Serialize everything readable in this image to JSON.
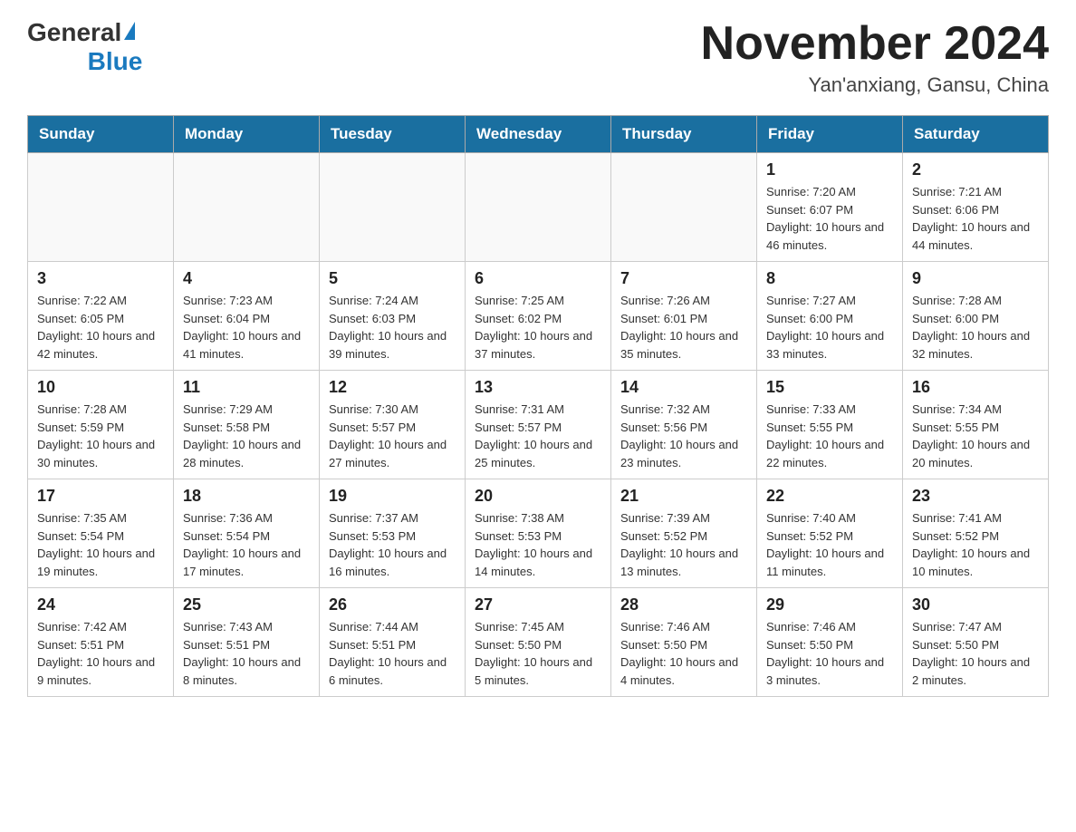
{
  "header": {
    "logo_general": "General",
    "logo_blue": "Blue",
    "month_title": "November 2024",
    "location": "Yan'anxiang, Gansu, China"
  },
  "days_of_week": [
    "Sunday",
    "Monday",
    "Tuesday",
    "Wednesday",
    "Thursday",
    "Friday",
    "Saturday"
  ],
  "weeks": [
    [
      {
        "day": "",
        "info": ""
      },
      {
        "day": "",
        "info": ""
      },
      {
        "day": "",
        "info": ""
      },
      {
        "day": "",
        "info": ""
      },
      {
        "day": "",
        "info": ""
      },
      {
        "day": "1",
        "info": "Sunrise: 7:20 AM\nSunset: 6:07 PM\nDaylight: 10 hours and 46 minutes."
      },
      {
        "day": "2",
        "info": "Sunrise: 7:21 AM\nSunset: 6:06 PM\nDaylight: 10 hours and 44 minutes."
      }
    ],
    [
      {
        "day": "3",
        "info": "Sunrise: 7:22 AM\nSunset: 6:05 PM\nDaylight: 10 hours and 42 minutes."
      },
      {
        "day": "4",
        "info": "Sunrise: 7:23 AM\nSunset: 6:04 PM\nDaylight: 10 hours and 41 minutes."
      },
      {
        "day": "5",
        "info": "Sunrise: 7:24 AM\nSunset: 6:03 PM\nDaylight: 10 hours and 39 minutes."
      },
      {
        "day": "6",
        "info": "Sunrise: 7:25 AM\nSunset: 6:02 PM\nDaylight: 10 hours and 37 minutes."
      },
      {
        "day": "7",
        "info": "Sunrise: 7:26 AM\nSunset: 6:01 PM\nDaylight: 10 hours and 35 minutes."
      },
      {
        "day": "8",
        "info": "Sunrise: 7:27 AM\nSunset: 6:00 PM\nDaylight: 10 hours and 33 minutes."
      },
      {
        "day": "9",
        "info": "Sunrise: 7:28 AM\nSunset: 6:00 PM\nDaylight: 10 hours and 32 minutes."
      }
    ],
    [
      {
        "day": "10",
        "info": "Sunrise: 7:28 AM\nSunset: 5:59 PM\nDaylight: 10 hours and 30 minutes."
      },
      {
        "day": "11",
        "info": "Sunrise: 7:29 AM\nSunset: 5:58 PM\nDaylight: 10 hours and 28 minutes."
      },
      {
        "day": "12",
        "info": "Sunrise: 7:30 AM\nSunset: 5:57 PM\nDaylight: 10 hours and 27 minutes."
      },
      {
        "day": "13",
        "info": "Sunrise: 7:31 AM\nSunset: 5:57 PM\nDaylight: 10 hours and 25 minutes."
      },
      {
        "day": "14",
        "info": "Sunrise: 7:32 AM\nSunset: 5:56 PM\nDaylight: 10 hours and 23 minutes."
      },
      {
        "day": "15",
        "info": "Sunrise: 7:33 AM\nSunset: 5:55 PM\nDaylight: 10 hours and 22 minutes."
      },
      {
        "day": "16",
        "info": "Sunrise: 7:34 AM\nSunset: 5:55 PM\nDaylight: 10 hours and 20 minutes."
      }
    ],
    [
      {
        "day": "17",
        "info": "Sunrise: 7:35 AM\nSunset: 5:54 PM\nDaylight: 10 hours and 19 minutes."
      },
      {
        "day": "18",
        "info": "Sunrise: 7:36 AM\nSunset: 5:54 PM\nDaylight: 10 hours and 17 minutes."
      },
      {
        "day": "19",
        "info": "Sunrise: 7:37 AM\nSunset: 5:53 PM\nDaylight: 10 hours and 16 minutes."
      },
      {
        "day": "20",
        "info": "Sunrise: 7:38 AM\nSunset: 5:53 PM\nDaylight: 10 hours and 14 minutes."
      },
      {
        "day": "21",
        "info": "Sunrise: 7:39 AM\nSunset: 5:52 PM\nDaylight: 10 hours and 13 minutes."
      },
      {
        "day": "22",
        "info": "Sunrise: 7:40 AM\nSunset: 5:52 PM\nDaylight: 10 hours and 11 minutes."
      },
      {
        "day": "23",
        "info": "Sunrise: 7:41 AM\nSunset: 5:52 PM\nDaylight: 10 hours and 10 minutes."
      }
    ],
    [
      {
        "day": "24",
        "info": "Sunrise: 7:42 AM\nSunset: 5:51 PM\nDaylight: 10 hours and 9 minutes."
      },
      {
        "day": "25",
        "info": "Sunrise: 7:43 AM\nSunset: 5:51 PM\nDaylight: 10 hours and 8 minutes."
      },
      {
        "day": "26",
        "info": "Sunrise: 7:44 AM\nSunset: 5:51 PM\nDaylight: 10 hours and 6 minutes."
      },
      {
        "day": "27",
        "info": "Sunrise: 7:45 AM\nSunset: 5:50 PM\nDaylight: 10 hours and 5 minutes."
      },
      {
        "day": "28",
        "info": "Sunrise: 7:46 AM\nSunset: 5:50 PM\nDaylight: 10 hours and 4 minutes."
      },
      {
        "day": "29",
        "info": "Sunrise: 7:46 AM\nSunset: 5:50 PM\nDaylight: 10 hours and 3 minutes."
      },
      {
        "day": "30",
        "info": "Sunrise: 7:47 AM\nSunset: 5:50 PM\nDaylight: 10 hours and 2 minutes."
      }
    ]
  ]
}
